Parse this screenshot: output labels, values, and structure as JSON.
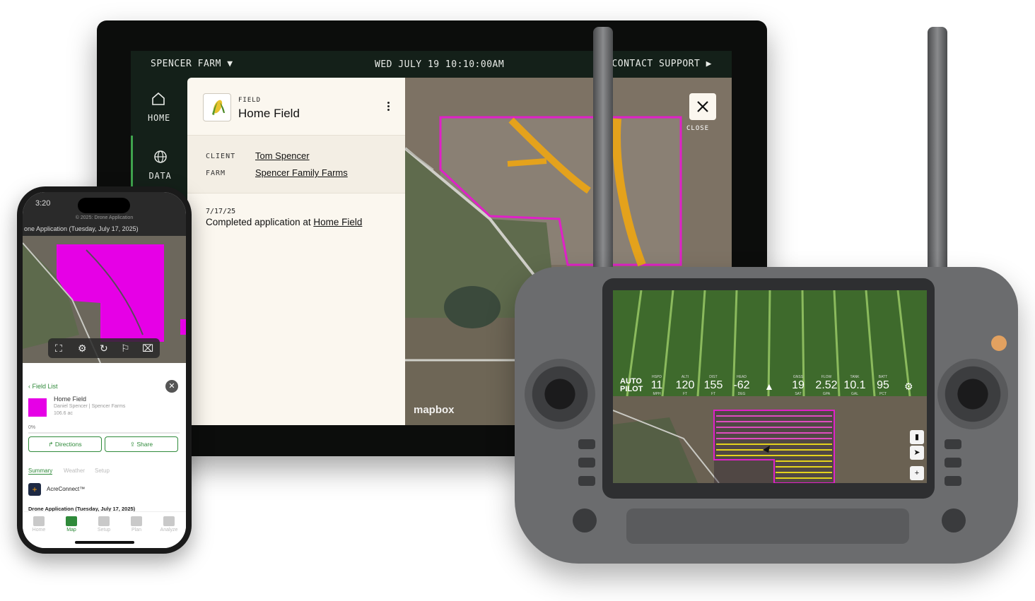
{
  "tablet": {
    "topbar": {
      "farm": "SPENCER FARM ▼",
      "datetime": "WED JULY 19 10:10:00AM",
      "support": "CONTACT SUPPORT ▶"
    },
    "nav": [
      {
        "label": "HOME",
        "icon": "home-icon"
      },
      {
        "label": "DATA",
        "icon": "globe-icon"
      }
    ],
    "field": {
      "tag": "FIELD",
      "name": "Home Field",
      "crop_icon": "corn-icon",
      "client_key": "CLIENT",
      "client": "Tom Spencer",
      "farm_key": "FARM",
      "farm": "Spencer Family Farms"
    },
    "activity": {
      "date": "7/17/25",
      "text": "Completed application at ",
      "link": "Home Field"
    },
    "map": {
      "close_label": "CLOSE",
      "attribution": "mapbox",
      "boundary_color": "#e020c8",
      "zone_color": "#e4a21c"
    }
  },
  "phone": {
    "time": "3:20",
    "note": "© 2025: Drone Application",
    "title": "one Application (Tuesday, July 17, 2025)",
    "sheet": {
      "back": "Field List",
      "field_name": "Home Field",
      "field_sub": "Daniel Spencer | Spencer Farms",
      "acres": "106.6 ac",
      "progress": "0%",
      "directions": "Directions",
      "share": "Share",
      "tabs": [
        "Summary",
        "Weather",
        "Setup"
      ],
      "integration": "AcreConnect™",
      "activity": "Drone Application (Tuesday, July 17, 2025)"
    },
    "tabbar": [
      "Home",
      "Map",
      "Setup",
      "Plan",
      "Analyze"
    ],
    "accent": "#2f8a3a",
    "map_fill": "#e600e6"
  },
  "controller": {
    "mode": "AUTO PILOT",
    "metrics": [
      {
        "label": "HSPD",
        "value": "11",
        "unit": "MPH"
      },
      {
        "label": "ALTI",
        "value": "120",
        "unit": "FT"
      },
      {
        "label": "DIST",
        "value": "155",
        "unit": "FT"
      },
      {
        "label": "HEAD",
        "value": "-62",
        "unit": "DEG"
      },
      {
        "label": "GNSS",
        "value": "19",
        "unit": "SAT"
      },
      {
        "label": "FLOW",
        "value": "2.52",
        "unit": "GPA"
      },
      {
        "label": "TANK",
        "value": "10.1",
        "unit": "GAL"
      },
      {
        "label": "BATT",
        "value": "95",
        "unit": "PCT"
      }
    ]
  }
}
